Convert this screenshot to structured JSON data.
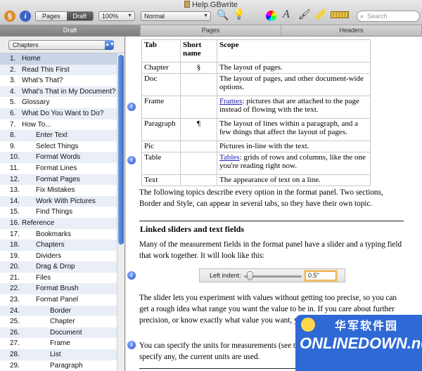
{
  "window": {
    "title": "Help.GBwrite"
  },
  "toolbar": {
    "view_segments": [
      "Pages",
      "Draft"
    ],
    "active_segment": "Draft",
    "zoom": "100%",
    "style": "Normal",
    "search_placeholder": "Search"
  },
  "tabs": [
    {
      "label": "Draft",
      "active": true
    },
    {
      "label": "Pages",
      "active": false
    },
    {
      "label": "Headers",
      "active": false
    }
  ],
  "sidebar": {
    "dropdown": "Chapters",
    "items": [
      {
        "num": "1.",
        "label": "Home",
        "indent": 0
      },
      {
        "num": "2.",
        "label": "Read This First",
        "indent": 0
      },
      {
        "num": "3.",
        "label": "What's That?",
        "indent": 0
      },
      {
        "num": "4.",
        "label": "What's That in My Document?",
        "indent": 0
      },
      {
        "num": "5.",
        "label": "Glossary",
        "indent": 0
      },
      {
        "num": "6.",
        "label": "What Do You Want to Do?",
        "indent": 0
      },
      {
        "num": "7.",
        "label": "How To...",
        "indent": 0
      },
      {
        "num": "8.",
        "label": "Enter Text",
        "indent": 1
      },
      {
        "num": "9.",
        "label": "Select Things",
        "indent": 1
      },
      {
        "num": "10.",
        "label": "Format Words",
        "indent": 1
      },
      {
        "num": "11.",
        "label": "Format Lines",
        "indent": 1
      },
      {
        "num": "12.",
        "label": "Format Pages",
        "indent": 1
      },
      {
        "num": "13.",
        "label": "Fix Mistakes",
        "indent": 1
      },
      {
        "num": "14.",
        "label": "Work With Pictures",
        "indent": 1
      },
      {
        "num": "15.",
        "label": "Find Things",
        "indent": 1
      },
      {
        "num": "16.",
        "label": "Reference",
        "indent": 0
      },
      {
        "num": "17.",
        "label": "Bookmarks",
        "indent": 1
      },
      {
        "num": "18.",
        "label": "Chapters",
        "indent": 1
      },
      {
        "num": "19.",
        "label": "Dividers",
        "indent": 1
      },
      {
        "num": "20.",
        "label": "Drag & Drop",
        "indent": 1
      },
      {
        "num": "21.",
        "label": "Files",
        "indent": 1
      },
      {
        "num": "22.",
        "label": "Format Brush",
        "indent": 1
      },
      {
        "num": "23.",
        "label": "Format Panel",
        "indent": 1
      },
      {
        "num": "24.",
        "label": "Border",
        "indent": 2
      },
      {
        "num": "25.",
        "label": "Chapter",
        "indent": 2
      },
      {
        "num": "26.",
        "label": "Document",
        "indent": 2
      },
      {
        "num": "27.",
        "label": "Frame",
        "indent": 2
      },
      {
        "num": "28.",
        "label": "List",
        "indent": 2
      },
      {
        "num": "29.",
        "label": "Paragraph",
        "indent": 2
      }
    ]
  },
  "doc": {
    "table": {
      "headers": [
        "Tab",
        "Short name",
        "Scope"
      ],
      "rows": [
        {
          "tab": "Chapter",
          "short": "§",
          "scope": "The layout of pages.",
          "link": ""
        },
        {
          "tab": "Doc",
          "short": "",
          "scope": "The layout of pages, and other document-wide options.",
          "link": ""
        },
        {
          "tab": "Frame",
          "short": "",
          "link": "Frames",
          "scope": ": pictures that are attached to the page instead of flowing with the text."
        },
        {
          "tab": "Paragraph",
          "short": "¶",
          "scope": "The layout of lines within a paragraph, and a few things that affect the layout of pages.",
          "link": ""
        },
        {
          "tab": "Pic",
          "short": "",
          "scope": "Pictures in-line with the text.",
          "link": ""
        },
        {
          "tab": "Table",
          "short": "",
          "link": "Tables",
          "scope": ": grids of rows and columns, like the one you're reading right now."
        },
        {
          "tab": "Text",
          "short": "",
          "scope": "The appearance of text on a line.",
          "link": ""
        }
      ]
    },
    "para1": "The following topics describe every option in the format panel. Two sections, Border and Style, can appear in several tabs, so they have their own topic.",
    "heading": "Linked sliders and text fields",
    "para2": "Many of the measurement fields in the format panel have a slider and a typing field that work together. It will look like this:",
    "slider": {
      "label": "Left indent:",
      "value": "0.5\"",
      "fraction": 0.05
    },
    "para3": "The slider lets you experiment with values without getting too precise, so you can get a rough idea what range you want the value to be in. If you care about further precision, or know exactly what value you want, you can type it in the text field.",
    "para4": "You can specify the units for measurements (see the Units section). If you don't specify any, the current units are used."
  },
  "watermark": {
    "cn": "华军软件园",
    "en": "ONLINEDOWN.net"
  },
  "colors": {
    "accent": "#3a6fcf",
    "selection": "#c9d4e7",
    "watermark": "#2f69d6"
  }
}
